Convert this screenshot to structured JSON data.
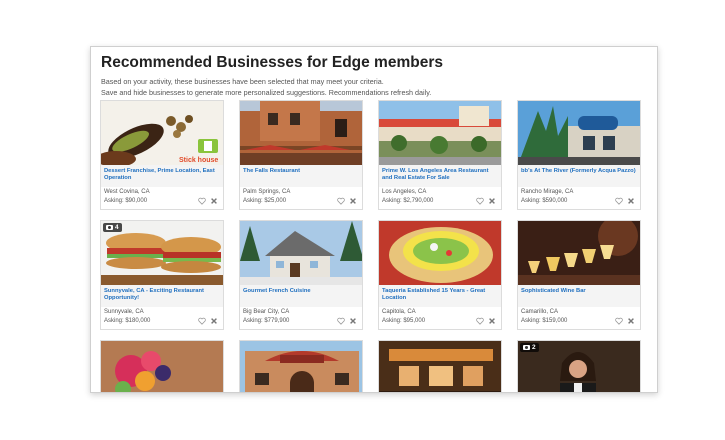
{
  "header": {
    "title": "Recommended Businesses for Edge members",
    "line1": "Based on your activity, these businesses have been selected that may meet your criteria.",
    "line2": "Save and hide businesses to generate more personalized suggestions. Recommendations refresh daily."
  },
  "cards": [
    {
      "name": "Dessert Franchise, Prime Location, East Operation",
      "location": "West Covina, CA",
      "asking": "Asking: $90,000",
      "logo": "Stick house"
    },
    {
      "name": "The Falls Restaurant",
      "location": "Palm Springs, CA",
      "asking": "Asking: $25,000"
    },
    {
      "name": "Prime W. Los Angeles Area Restaurant and Real Estate For Sale",
      "location": "Los Angeles, CA",
      "asking": "Asking: $2,790,000"
    },
    {
      "name": "bb's At The River (Formerly Acqua Pazzo)",
      "location": "Rancho Mirage, CA",
      "asking": "Asking: $590,000"
    },
    {
      "name": "Sunnyvale, CA - Exciting Restaurant Opportunity!",
      "location": "Sunnyvale, CA",
      "asking": "Asking: $180,000",
      "photo_count": "4"
    },
    {
      "name": "Gourmet French Cuisine",
      "location": "Big Bear City, CA",
      "asking": "Asking: $779,900"
    },
    {
      "name": "Taqueria Established 15 Years - Great Location",
      "location": "Capitola, CA",
      "asking": "Asking: $95,000"
    },
    {
      "name": "Sophisticated Wine Bar",
      "location": "Camarillo, CA",
      "asking": "Asking: $159,000"
    },
    {},
    {},
    {},
    {
      "photo_count": "2"
    }
  ]
}
